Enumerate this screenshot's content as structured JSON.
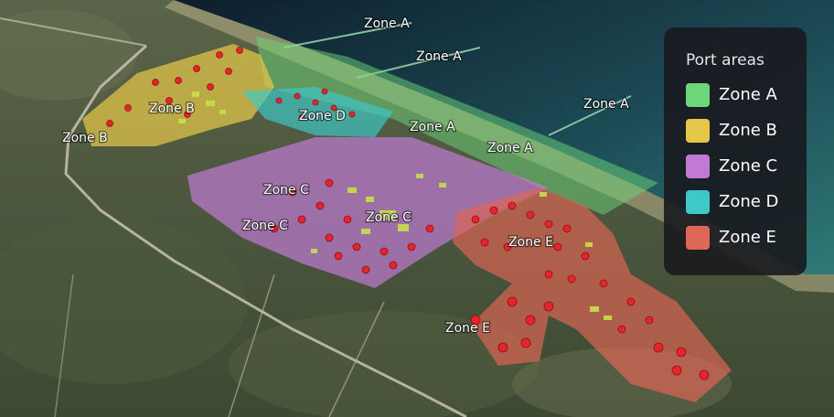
{
  "legend": {
    "title": "Port areas",
    "items": [
      {
        "label": "Zone A",
        "color": "#6ed67a"
      },
      {
        "label": "Zone B",
        "color": "#e5c84a"
      },
      {
        "label": "Zone C",
        "color": "#c07ad4"
      },
      {
        "label": "Zone D",
        "color": "#3ec8c8"
      },
      {
        "label": "Zone E",
        "color": "#e06656"
      }
    ]
  },
  "map_labels": {
    "zone_a": "Zone A",
    "zone_b": "Zone B",
    "zone_c": "Zone C",
    "zone_d": "Zone D",
    "zone_e": "Zone E"
  }
}
